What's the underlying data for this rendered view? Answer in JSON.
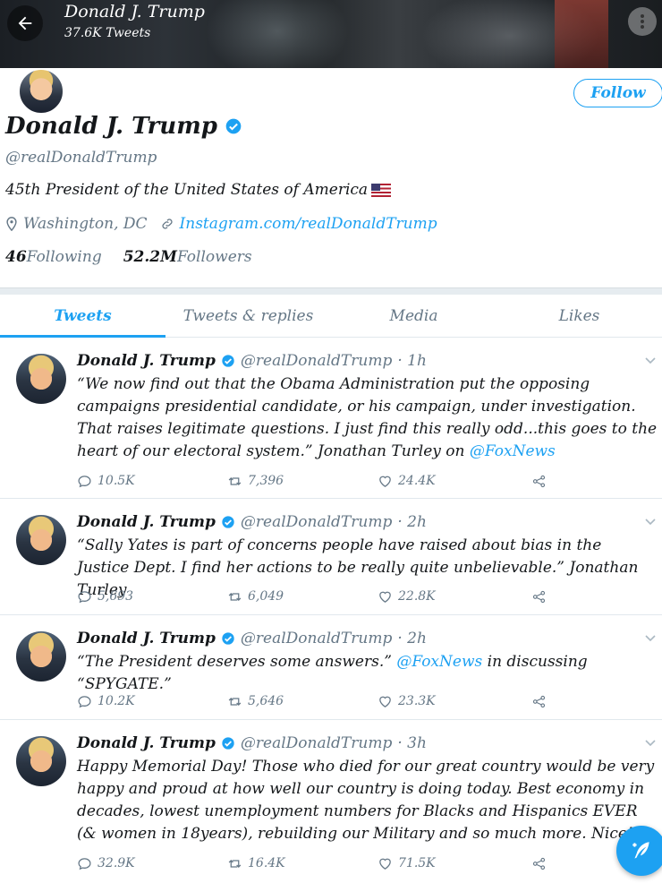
{
  "header": {
    "title": "Donald J. Trump",
    "subtitle": "37.6K Tweets"
  },
  "profile": {
    "name": "Donald J. Trump",
    "handle": "@realDonaldTrump",
    "bio": "45th President of the United States of America",
    "location": "Washington, DC",
    "link": "Instagram.com/realDonaldTrump",
    "following_count": "46",
    "following_label": "Following",
    "followers_count": "52.2M",
    "followers_label": "Followers",
    "follow_label": "Follow"
  },
  "tabs": [
    {
      "label": "Tweets",
      "active": true
    },
    {
      "label": "Tweets & replies"
    },
    {
      "label": "Media"
    },
    {
      "label": "Likes"
    }
  ],
  "tweets": [
    {
      "name": "Donald J. Trump",
      "handle": "@realDonaldTrump",
      "time": "· 1h",
      "text_before": "“We now find out that the Obama Administration put the opposing campaigns presidential candidate, or his campaign, under investigation. That raises legitimate questions. I just find this really odd...this goes to the heart of our electoral system.” Jonathan Turley on ",
      "mention": "@FoxNews",
      "text_after": "",
      "replies": "10.5K",
      "retweets": "7,396",
      "likes": "24.4K"
    },
    {
      "name": "Donald J. Trump",
      "handle": "@realDonaldTrump",
      "time": "· 2h",
      "text_before": "“Sally Yates is part of concerns people have raised about bias in the Justice Dept. I find her actions to be really quite unbelievable.” Jonathan Turley",
      "mention": "",
      "text_after": "",
      "replies": "5,693",
      "retweets": "6,049",
      "likes": "22.8K"
    },
    {
      "name": "Donald J. Trump",
      "handle": "@realDonaldTrump",
      "time": "· 2h",
      "text_before": "“The President deserves some answers.” ",
      "mention": "@FoxNews",
      "text_after": " in discussing “SPYGATE.”",
      "replies": "10.2K",
      "retweets": "5,646",
      "likes": "23.3K"
    },
    {
      "name": "Donald J. Trump",
      "handle": "@realDonaldTrump",
      "time": "· 3h",
      "text_before": "Happy Memorial Day! Those who died for our great country would be very happy and proud at how well our country is doing today. Best economy in decades, lowest unemployment numbers for Blacks and Hispanics EVER (& women in 18years), rebuilding our Military and so much more. Nice!",
      "mention": "",
      "text_after": "",
      "replies": "32.9K",
      "retweets": "16.4K",
      "likes": "71.5K"
    }
  ],
  "colors": {
    "accent": "#1da1f2",
    "muted": "#657786",
    "text": "#14171a"
  },
  "icons": {
    "back": "arrow-left-icon",
    "more": "vertical-dots-icon",
    "verified": "verified-badge-icon",
    "location": "location-pin-icon",
    "link": "link-icon",
    "reply": "reply-icon",
    "retweet": "retweet-icon",
    "like": "heart-icon",
    "share": "share-icon",
    "compose": "compose-feather-icon"
  }
}
